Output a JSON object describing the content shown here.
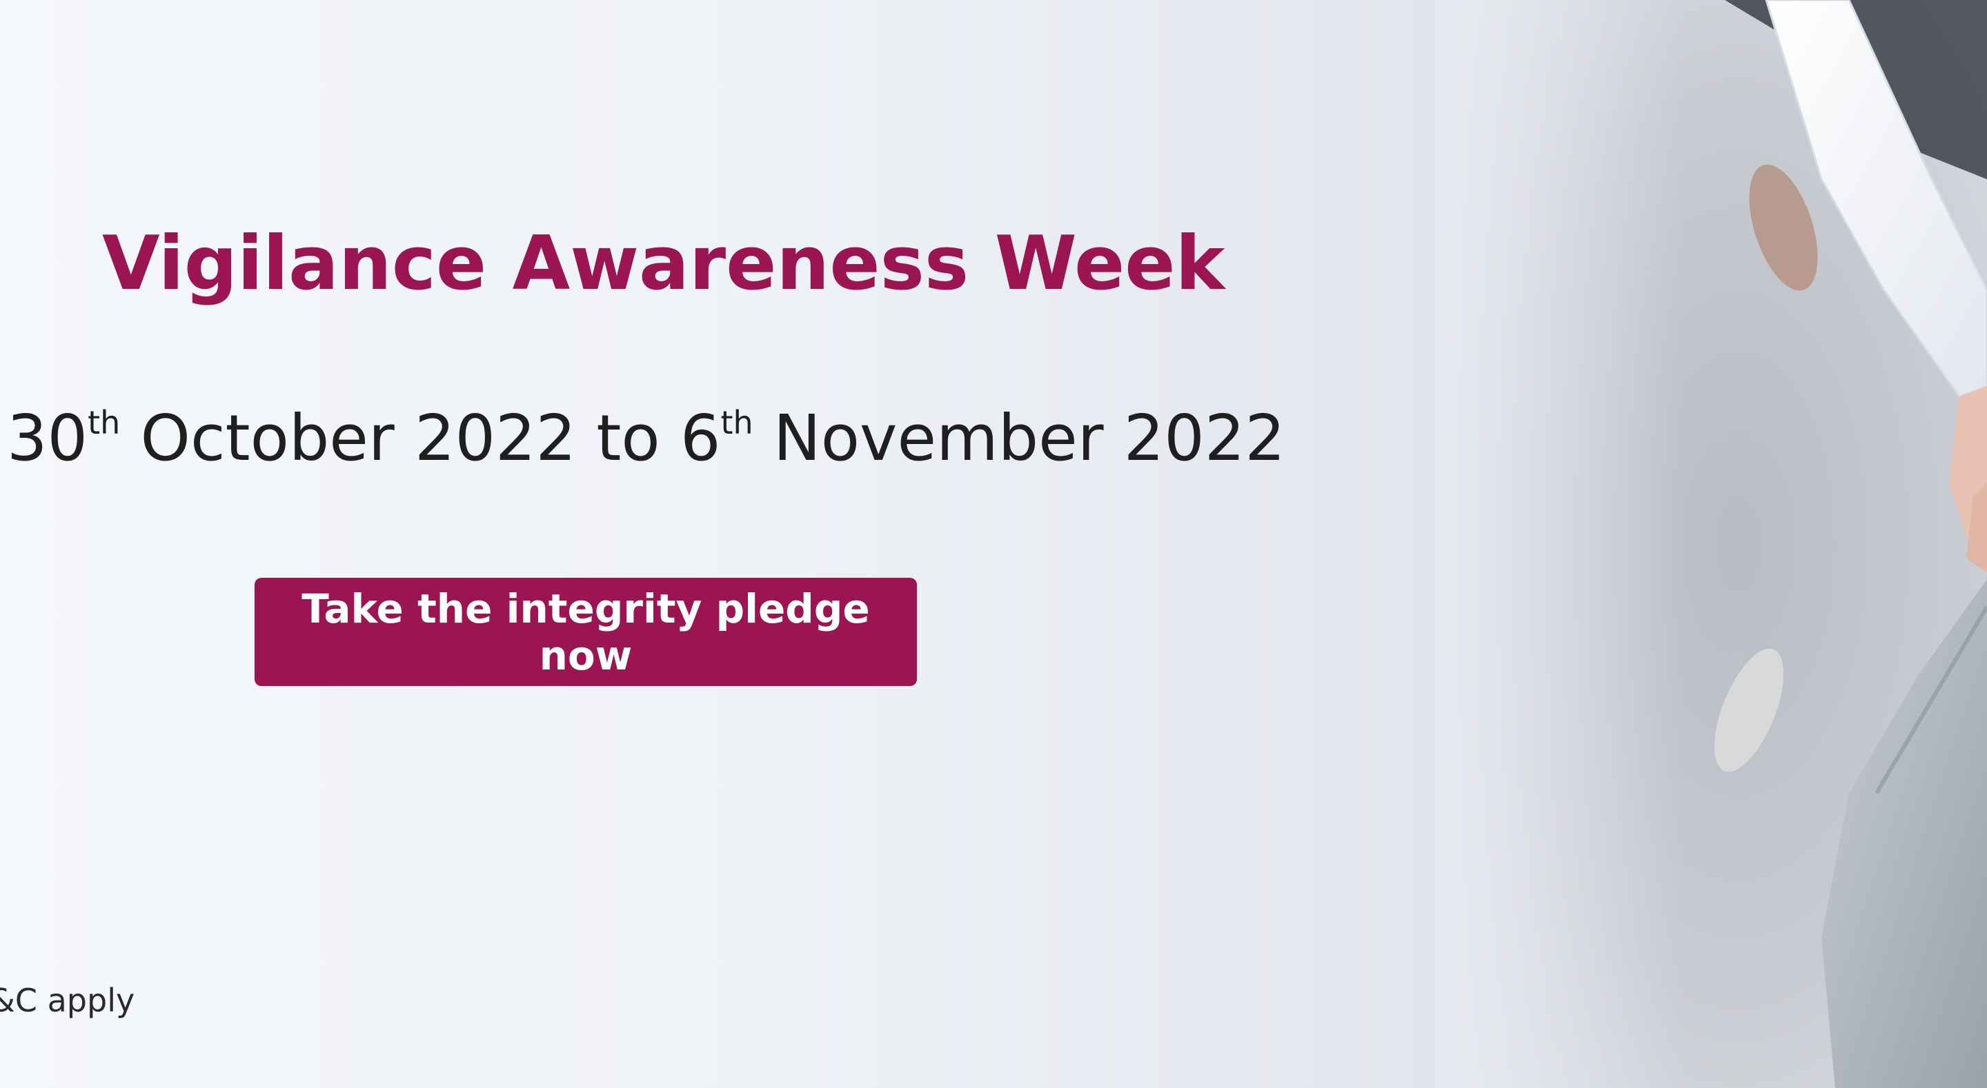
{
  "banner": {
    "title": "Vigilance Awareness Week",
    "dates": {
      "start_day": "30",
      "start_suffix": "th",
      "start_rest": " October 2022 to ",
      "end_day": "6",
      "end_suffix": "th",
      "end_rest": " November 2022"
    },
    "cta_label": "Take the integrity pledge now",
    "terms_text": "&C apply"
  },
  "colors": {
    "brand": "#9b1552",
    "text": "#1f1f1f",
    "background": "#f3f5f9"
  },
  "image": {
    "subject": "handshake-photo"
  }
}
